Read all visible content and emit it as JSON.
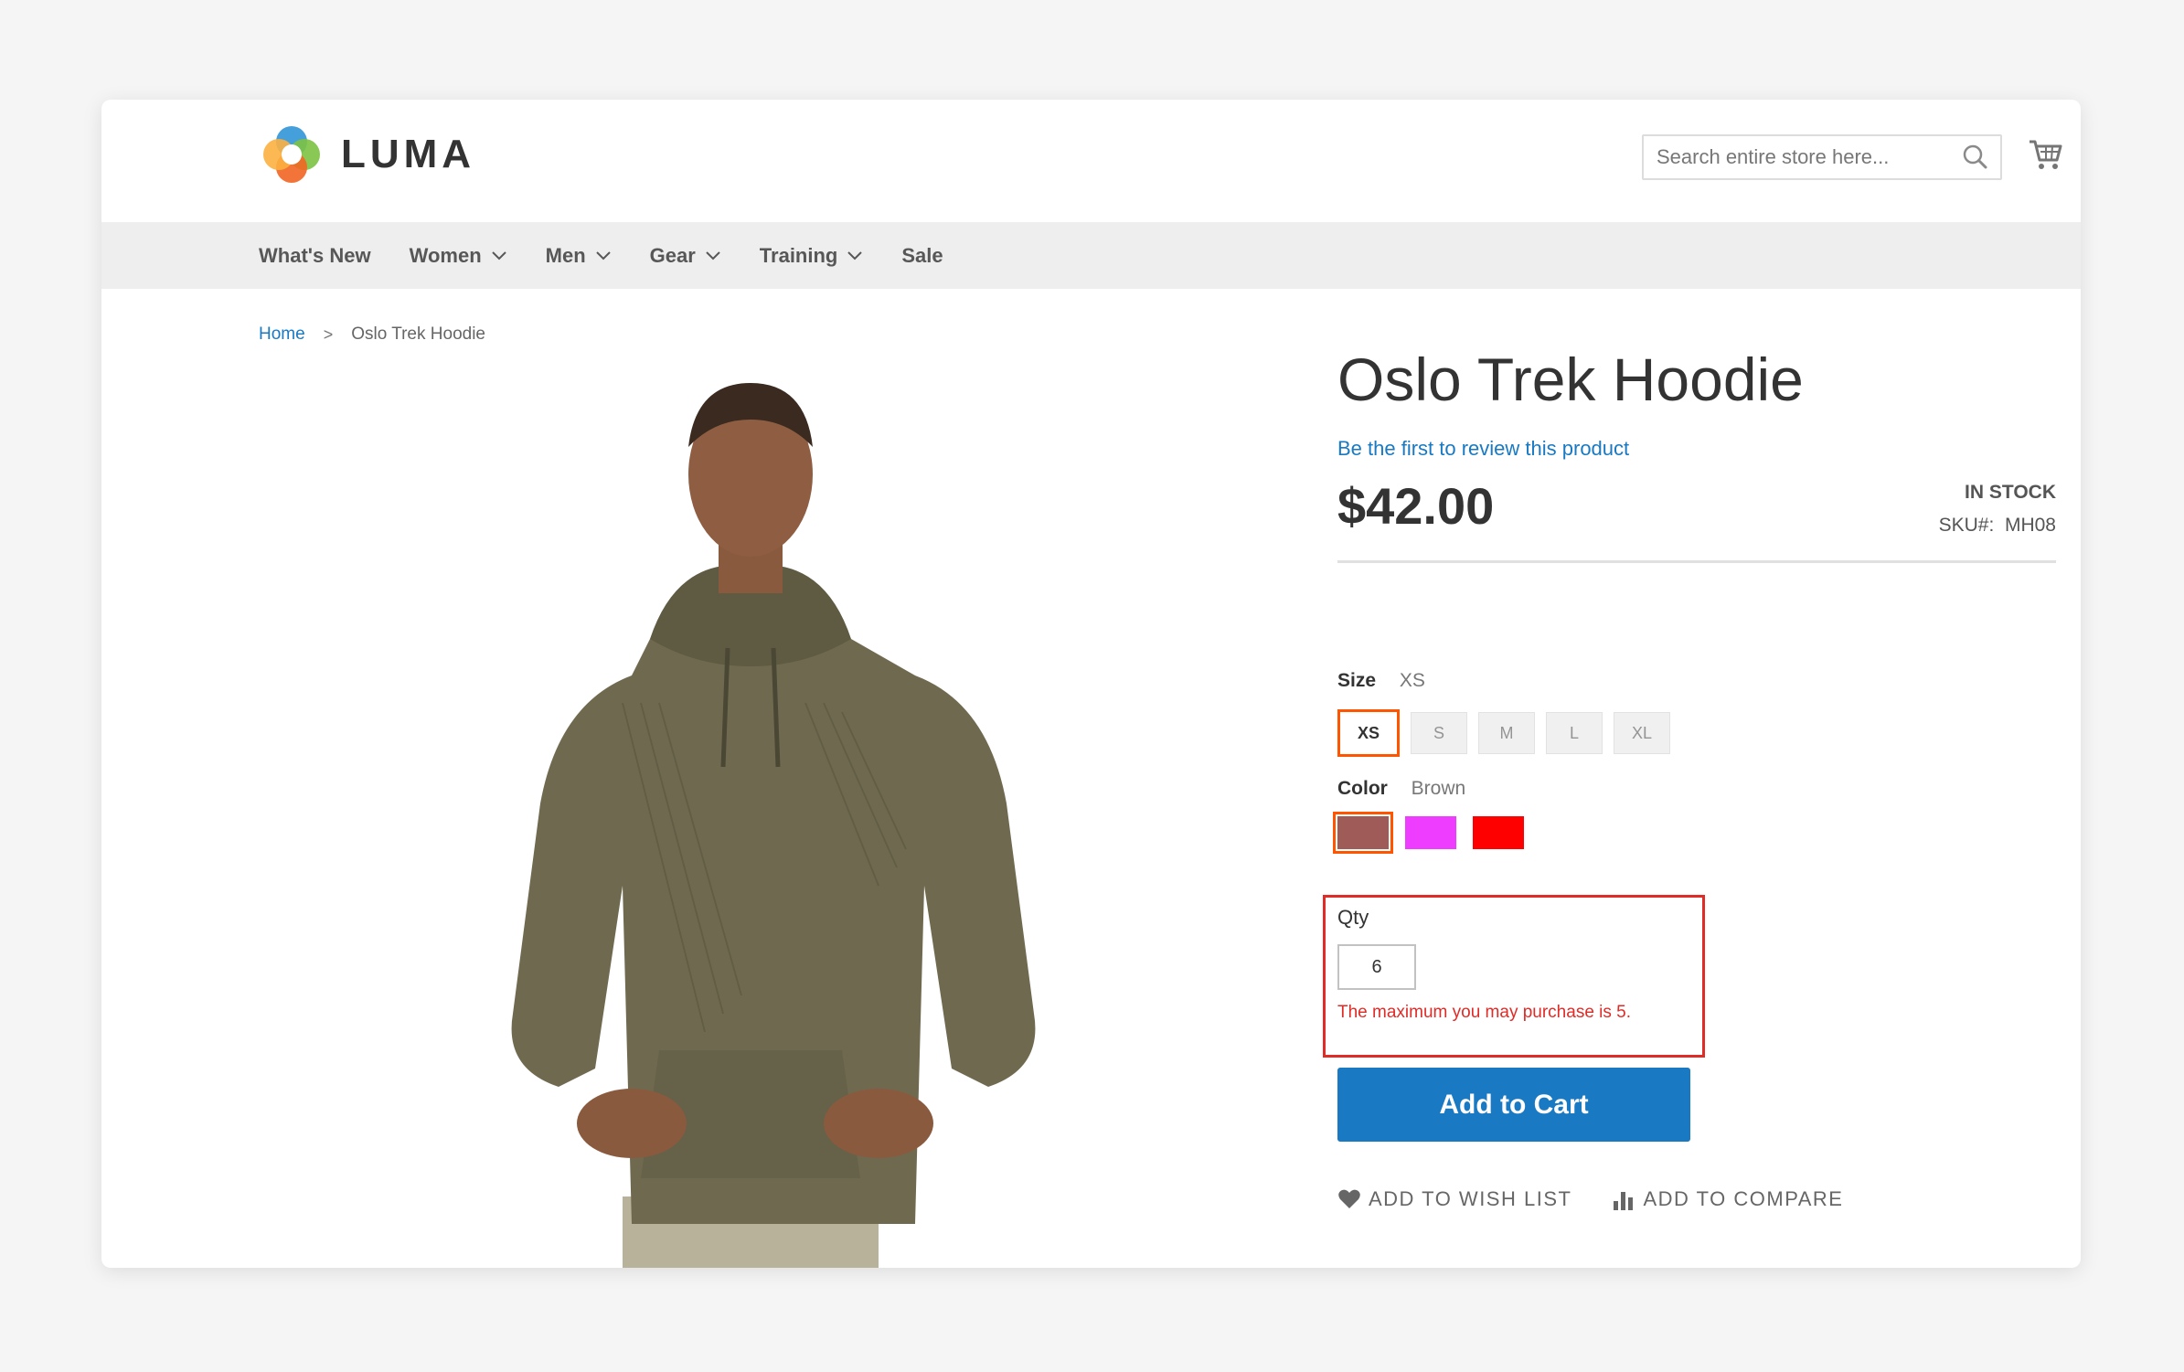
{
  "brand": {
    "name": "LUMA",
    "logo_icon": "luma-logo-icon"
  },
  "search": {
    "placeholder": "Search entire store here...",
    "icon": "search-icon"
  },
  "cart": {
    "icon": "cart-icon"
  },
  "nav": [
    {
      "label": "What's New",
      "has_dropdown": false
    },
    {
      "label": "Women",
      "has_dropdown": true
    },
    {
      "label": "Men",
      "has_dropdown": true
    },
    {
      "label": "Gear",
      "has_dropdown": true
    },
    {
      "label": "Training",
      "has_dropdown": true
    },
    {
      "label": "Sale",
      "has_dropdown": false
    }
  ],
  "breadcrumb": {
    "home": "Home",
    "separator": ">",
    "current": "Oslo Trek Hoodie"
  },
  "product": {
    "title": "Oslo Trek Hoodie",
    "review_link": "Be the first to review this product",
    "price": "$42.00",
    "stock": "IN STOCK",
    "sku_label": "SKU#:",
    "sku": "MH08",
    "size": {
      "label": "Size",
      "selected": "XS",
      "options": [
        "XS",
        "S",
        "M",
        "L",
        "XL"
      ]
    },
    "color": {
      "label": "Color",
      "selected": "Brown",
      "options": [
        {
          "name": "Brown",
          "hex": "#9e5b57"
        },
        {
          "name": "Purple",
          "hex": "#ef3dff"
        },
        {
          "name": "Red",
          "hex": "#ff0000"
        }
      ]
    },
    "qty": {
      "label": "Qty",
      "value": "6",
      "error": "The maximum you may purchase is 5."
    },
    "add_to_cart": "Add to Cart",
    "wish_list": "ADD TO WISH LIST",
    "compare": "ADD TO COMPARE"
  },
  "colors": {
    "accent": "#1979c3",
    "selected_outline": "#ff5501",
    "error": "#e02b27",
    "nav_bg": "#eeeeee"
  }
}
